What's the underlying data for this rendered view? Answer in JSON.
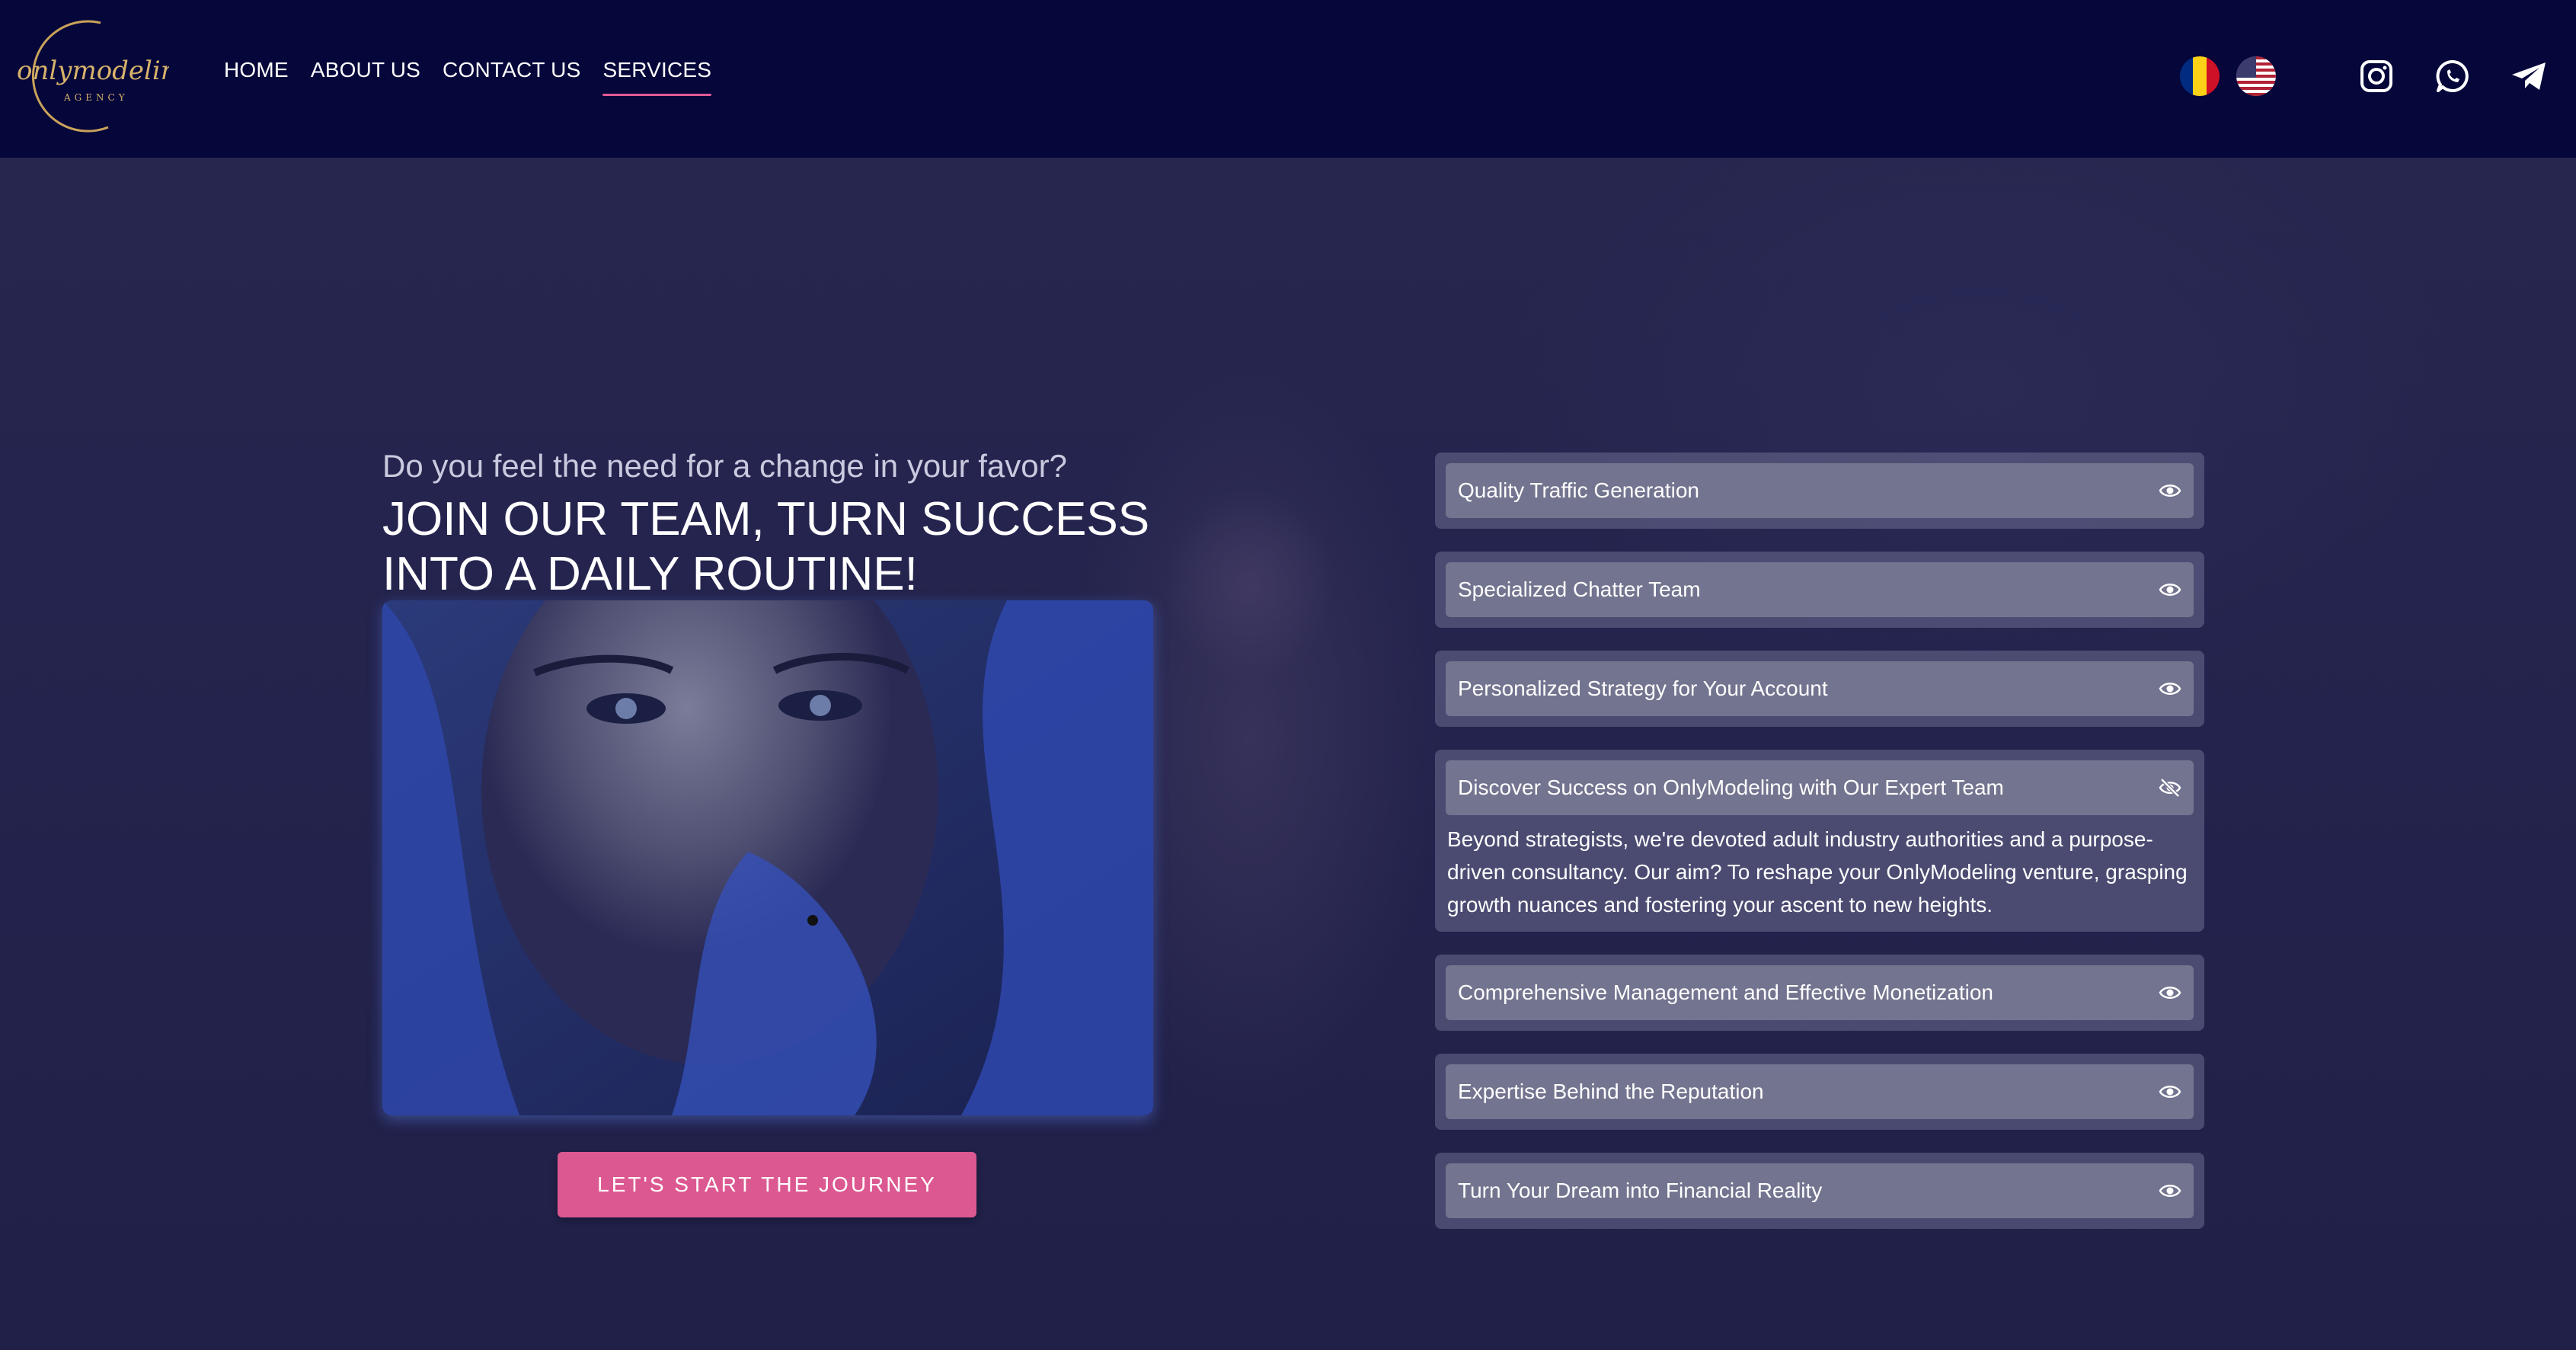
{
  "header": {
    "logo_text": "onlymodeling",
    "logo_subtext": "AGENCY",
    "nav": [
      {
        "label": "HOME",
        "active": false
      },
      {
        "label": "ABOUT US",
        "active": false
      },
      {
        "label": "CONTACT US",
        "active": false
      },
      {
        "label": "SERVICES",
        "active": true
      }
    ],
    "languages": [
      "romanian-flag-icon",
      "us-flag-icon"
    ],
    "social": [
      "instagram-icon",
      "whatsapp-icon",
      "telegram-icon"
    ],
    "accent_color": "#e05a96",
    "bg_color": "#05063a"
  },
  "hero": {
    "kicker": "Do you feel the need for a change in your favor?",
    "headline_line1": "JOIN OUR TEAM, TURN SUCCESS",
    "headline_line2": "INTO A DAILY ROUTINE!",
    "cta_label": "LET'S START THE JOURNEY",
    "cta_color": "#dc5890"
  },
  "accordion": {
    "items": [
      {
        "title": "Quality Traffic Generation",
        "icon": "eye-icon"
      },
      {
        "title": "Specialized Chatter Team",
        "icon": "eye-icon"
      },
      {
        "title": "Personalized Strategy for Your Account",
        "icon": "eye-icon"
      },
      {
        "title": "Discover Success on OnlyModeling with Our Expert Team",
        "icon": "eye-off-icon",
        "body": "Beyond strategists, we're devoted adult industry authorities and a purpose-driven consultancy. Our aim? To reshape your OnlyModeling venture, grasping growth nuances and fostering your ascent to new heights."
      },
      {
        "title": "Comprehensive Management and Effective Monetization",
        "icon": "eye-icon"
      },
      {
        "title": "Expertise Behind the Reputation",
        "icon": "eye-icon"
      },
      {
        "title": "Turn Your Dream into Financial Reality",
        "icon": "eye-icon"
      }
    ]
  }
}
